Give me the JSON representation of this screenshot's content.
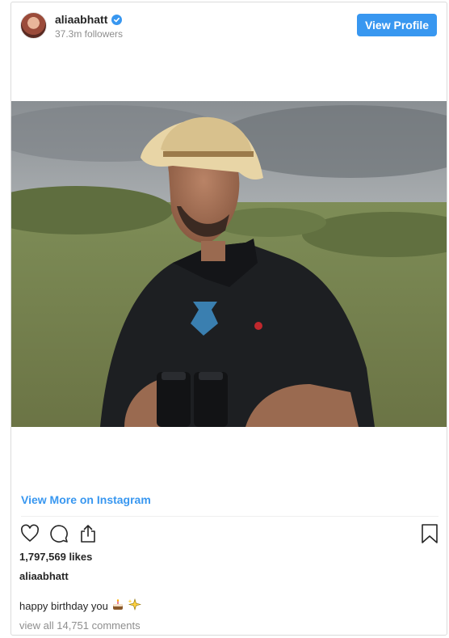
{
  "header": {
    "username": "aliaabhatt",
    "followers": "37.3m followers",
    "view_profile_label": "View Profile"
  },
  "post": {
    "view_more_label": "View More on Instagram",
    "likes": "1,797,569 likes",
    "author": "aliaabhatt",
    "caption": "happy birthday you",
    "caption_emojis": [
      "cake-emoji",
      "sparkles-emoji"
    ],
    "comments_link": "view all 14,751 comments"
  },
  "icons": {
    "verified": "verified-badge-icon",
    "like": "heart-icon",
    "comment": "comment-icon",
    "share": "share-icon",
    "save": "bookmark-icon"
  },
  "colors": {
    "accent": "#3897f0",
    "text": "#262626",
    "muted": "#8e8e8e",
    "border": "#dbdbdb"
  }
}
